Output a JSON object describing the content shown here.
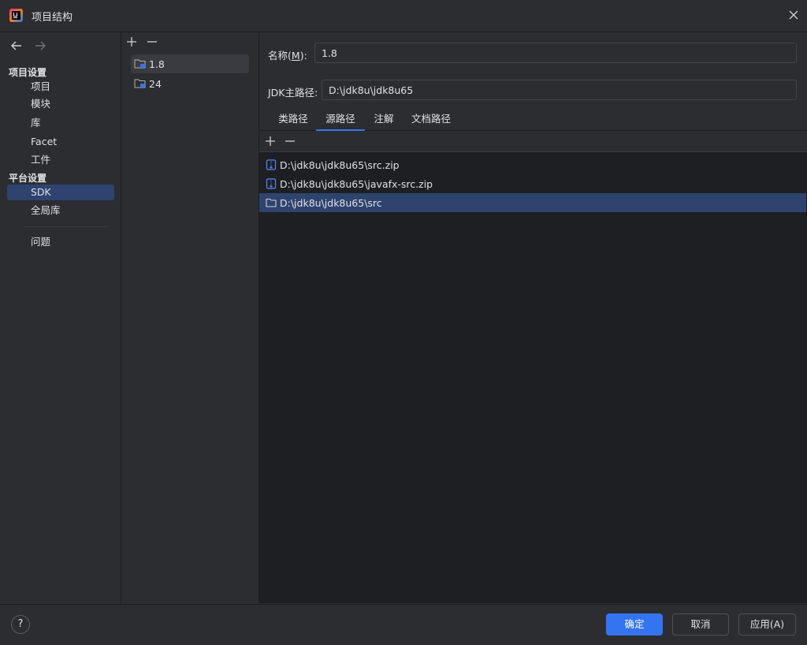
{
  "window": {
    "title": "项目结构",
    "app_icon": "intellij-idea-logo-icon"
  },
  "nav": {
    "back_icon": "arrow-left-icon",
    "forward_icon": "arrow-right-icon",
    "group1": "项目设置",
    "group1_items": [
      "项目",
      "模块",
      "库",
      "Facet",
      "工件"
    ],
    "group2": "平台设置",
    "group2_items": [
      "SDK",
      "全局库"
    ],
    "problems": "问题",
    "selected": "SDK"
  },
  "sdk_list": {
    "items": [
      {
        "label": "1.8",
        "icon": "jdk-folder-icon",
        "selected": true
      },
      {
        "label": "24",
        "icon": "jdk-folder-icon",
        "selected": false
      }
    ]
  },
  "detail": {
    "name_label": "名称(M):",
    "name_label_pre": "名称(",
    "name_label_mn": "M",
    "name_label_post": "):",
    "name_value": "1.8",
    "home_label": "JDK主路径:",
    "home_value": "D:\\jdk8u\\jdk8u65",
    "tabs": [
      "类路径",
      "源路径",
      "注解",
      "文档路径"
    ],
    "active_tab": "源路径",
    "paths": [
      {
        "label": "D:\\jdk8u\\jdk8u65\\src.zip",
        "icon": "archive-icon",
        "selected": false
      },
      {
        "label": "D:\\jdk8u\\jdk8u65\\javafx-src.zip",
        "icon": "archive-icon",
        "selected": false
      },
      {
        "label": "D:\\jdk8u\\jdk8u65\\src",
        "icon": "folder-icon",
        "selected": true
      }
    ]
  },
  "footer": {
    "help": "?",
    "ok": "确定",
    "cancel": "取消",
    "apply": "应用(A)"
  },
  "colors": {
    "background": "#2b2d30",
    "panel_dark": "#1e1f22",
    "accent": "#3574f0",
    "selection": "#2e436e"
  }
}
